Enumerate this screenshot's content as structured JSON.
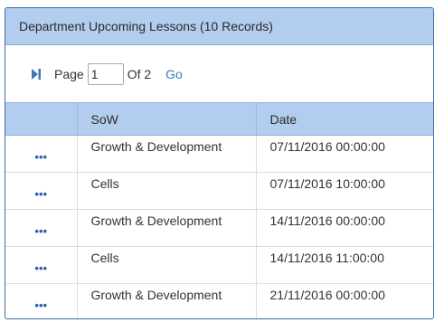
{
  "panel": {
    "title": "Department Upcoming Lessons (10 Records)"
  },
  "pager": {
    "page_label": "Page",
    "page_value": "1",
    "of_label": "Of 2",
    "go_label": "Go",
    "next_icon": "skip-next-icon"
  },
  "table": {
    "columns": [
      "",
      "SoW",
      "Date"
    ],
    "action_label": "•••",
    "rows": [
      {
        "sow": "Growth & Development",
        "date": "07/11/2016 00:00:00"
      },
      {
        "sow": "Cells",
        "date": "07/11/2016 10:00:00"
      },
      {
        "sow": "Growth & Development",
        "date": "14/11/2016 00:00:00"
      },
      {
        "sow": "Cells",
        "date": "14/11/2016 11:00:00"
      },
      {
        "sow": "Growth & Development",
        "date": "21/11/2016 00:00:00"
      }
    ]
  },
  "colors": {
    "header_bg": "#b3cdee",
    "border": "#3d6ea9",
    "link": "#3a78b8",
    "dots": "#2e63b5"
  }
}
